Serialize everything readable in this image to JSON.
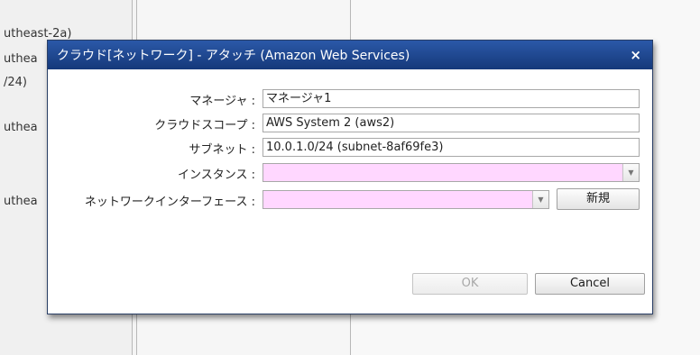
{
  "background": {
    "texts": [
      "utheast-2a)",
      "uthea",
      "/24)",
      "uthea",
      "uthea"
    ]
  },
  "dialog": {
    "title": "クラウド[ネットワーク] - アタッチ (Amazon Web Services)",
    "close_symbol": "×",
    "fields": [
      {
        "label": "マネージャ :",
        "value": "マネージャ1"
      },
      {
        "label": "クラウドスコープ :",
        "value": "AWS System 2 (aws2)"
      },
      {
        "label": "サブネット :",
        "value": "10.0.1.0/24 (subnet-8af69fe3)"
      },
      {
        "label": "インスタンス :",
        "value": ""
      },
      {
        "label": "ネットワークインターフェース :",
        "value": ""
      }
    ],
    "new_button": "新規",
    "ok_button": "OK",
    "cancel_button": "Cancel"
  },
  "colors": {
    "titlebar": "#1f4a94",
    "required_field": "#ffd7ff"
  }
}
